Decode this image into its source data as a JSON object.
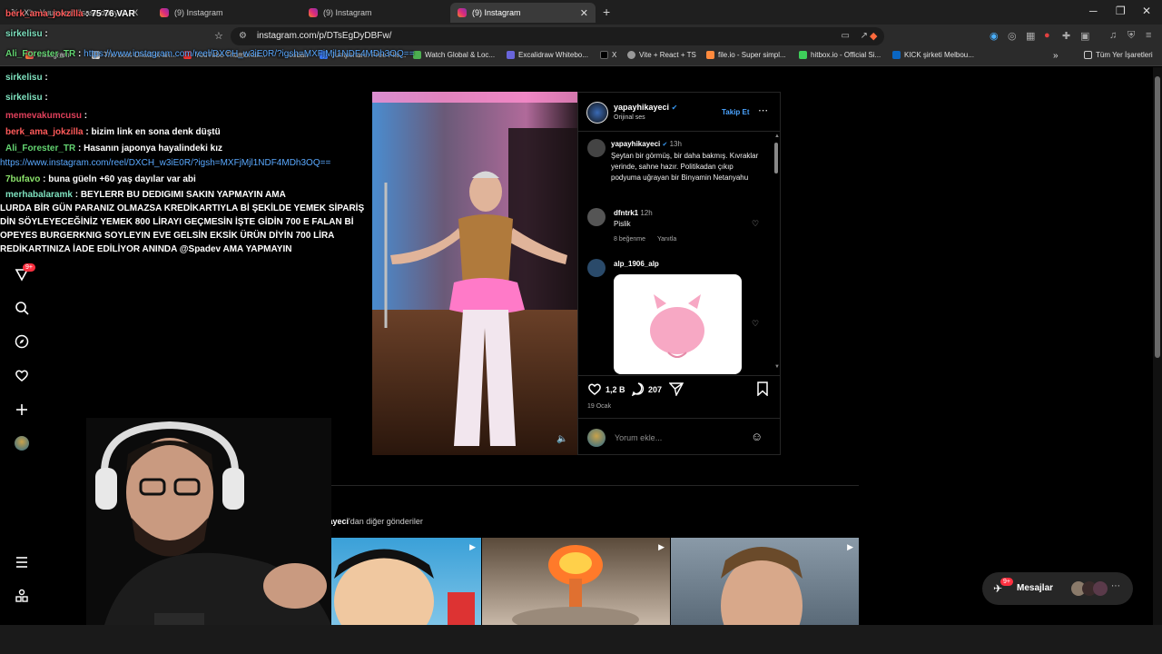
{
  "browser": {
    "tabs": [
      {
        "label": "X'te Yuusuuuf: \"sasa dünya\" / X"
      },
      {
        "label": "(9) Instagram"
      },
      {
        "label": "(9) Instagram"
      },
      {
        "label": "(9) Instagram",
        "active": true
      }
    ],
    "url": "instagram.com/p/DTsEgDyDBFw/",
    "bookmarks": [
      "Instagram",
      "The best ChatBot an...",
      "YouTube Thumbnail...",
      "cobalt",
      "Jumpshare: Free File...",
      "Watch Global & Loc...",
      "Excalidraw Whitebo...",
      "X",
      "Vite + React + TS",
      "file.io - Super simpl...",
      "hitbox.io - Official Si...",
      "KICK şirketi Melbou..."
    ],
    "all_bookmarks_label": "Tüm Yer İşaretleri"
  },
  "chat": [
    {
      "user": "berk_ama_jokzilla",
      "user_color": "#ff5a5a",
      "text": "75 76 VAR"
    },
    {
      "user": "sirkelisu",
      "user_color": "#7fe3c0",
      "text": ""
    },
    {
      "user": "Ali_Forester_TR",
      "user_color": "#63d471",
      "text": "",
      "link": "https://www.instagram.com/reel/DXCH_w3iE0R/?igsh=MXFjMjl1NDF4MDh3OQ=="
    },
    {
      "user": "sirkelisu",
      "user_color": "#7fe3c0",
      "text": ""
    },
    {
      "user": "sirkelisu",
      "user_color": "#7fe3c0",
      "text": ""
    },
    {
      "user": "memevakumcusu",
      "user_color": "#e0405b",
      "text": ""
    },
    {
      "user": "berk_ama_jokzilla",
      "user_color": "#ff5a5a",
      "text": "bizim link en sona denk düştü"
    },
    {
      "user": "Ali_Forester_TR",
      "user_color": "#63d471",
      "text": "Hasanın japonya hayalindeki kız"
    },
    {
      "user": "",
      "user_color": "#fff",
      "text": "",
      "link": "https://www.instagram.com/reel/DXCH_w3iE0R/?igsh=MXFjMjl1NDF4MDh3OQ=="
    },
    {
      "user": "7bufavo",
      "user_color": "#8be36b",
      "text": "buna güeln +60 yaş dayılar var abi"
    },
    {
      "user": "merhabalaramk",
      "user_color": "#7fe3c0",
      "text": "BEYLERR BU DEDIGIMI SAKIN YAPMAYIN AMA"
    },
    {
      "user": "",
      "user_color": "#fff",
      "text": "LURDA BİR GÜN PARANIZ OLMAZSA KREDİKARTIYLA Bİ ŞEKİLDE YEMEK SİPARİŞ"
    },
    {
      "user": "",
      "user_color": "#fff",
      "text": "DİN SÖYLEYECEĞİNİZ YEMEK 800 LİRAYI GEÇMESİN İŞTE GİDİN 700 E FALAN Bİ"
    },
    {
      "user": "",
      "user_color": "#fff",
      "text": "OPEYES BURGERKNIG SOYLEYIN EVE GELSİN EKSİK ÜRÜN DİYİN 700 LİRA"
    },
    {
      "user": "",
      "user_color": "#fff",
      "text": "REDİKARTINIZA İADE EDİLİYOR ANINDA @Spadev AMA YAPMAYIN"
    }
  ],
  "sidebar": {
    "notification_badge": "9+"
  },
  "post": {
    "author": "yapayhikayeci",
    "audio": "Orijinal ses",
    "follow_label": "Takip Et",
    "caption_author": "yapayhikayeci",
    "caption_time": "13h",
    "caption": "Şeytan bir görmüş, bir daha bakmış. Kıvraklar yerinde, sahne hazır. Politikadan çıkıp podyuma uğrayan bir Binyamin Netanyahu",
    "comments": [
      {
        "user": "dfntrk1",
        "time": "12h",
        "text": "Pislik",
        "likes": "8 beğenme",
        "reply": "Yanıtla"
      },
      {
        "user": "alp_1906_alp",
        "time": "",
        "text": "",
        "likes": "",
        "reply": ""
      }
    ],
    "like_count": "1,2 B",
    "comment_count": "207",
    "date": "19 Ocak",
    "comment_placeholder": "Yorum ekle..."
  },
  "more_posts": {
    "author": "yapayhikayeci",
    "suffix": "'dan diğer gönderiler"
  },
  "messages": {
    "label": "Mesajlar",
    "badge": "9+"
  }
}
